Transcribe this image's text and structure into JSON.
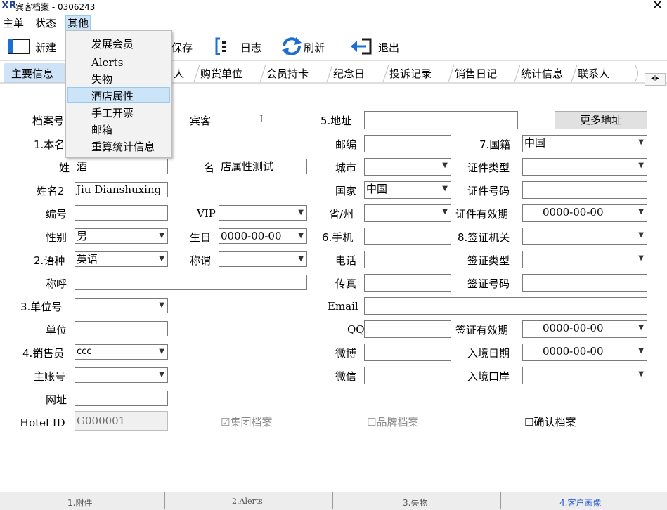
{
  "window": {
    "title": "宾客档案 - 0306243",
    "logo": "XR",
    "close": "✕"
  },
  "menubar": [
    "主单",
    "状态",
    "其他"
  ],
  "toolbar": {
    "new": "新建",
    "save": "保存",
    "log": "日志",
    "refresh": "刷新",
    "exit": "退出"
  },
  "tabs": [
    "主要信息",
    "人",
    "购货单位",
    "会员持卡",
    "纪念日",
    "投诉记录",
    "销售日记",
    "统计信息",
    "联系人"
  ],
  "dropdown_menu": [
    "发展会员",
    "Alerts",
    "失物",
    "酒店属性",
    "手工开票",
    "邮箱",
    "重算统计信息"
  ],
  "left": {
    "archive_no_label": "档案号",
    "guest_label": "宾客",
    "guest_value": "I",
    "name_section_label": "1.本名",
    "surname_label": "姓",
    "surname_value": "酒",
    "given_label": "名",
    "given_value": "店属性测试",
    "name2_label": "姓名2",
    "name2_value": "Jiu Dianshuxing",
    "code_label": "编号",
    "vip_label": "VIP",
    "gender_label": "性别",
    "gender_value": "男",
    "birthday_label": "生日",
    "birthday_value": "0000-00-00",
    "language_label": "2.语种",
    "language_value": "英语",
    "title_label": "称谓",
    "salutation_label": "称呼",
    "unit_no_label": "3.单位号",
    "unit_label": "单位",
    "salesman_label": "4.销售员",
    "salesman_value": "ccc",
    "master_acct_label": "主账号",
    "website_label": "网址",
    "hotel_id_label": "Hotel ID",
    "hotel_id_value": "G000001",
    "group_archive": "☑集团档案",
    "brand_archive": "☐品牌档案",
    "confirm_archive": "☐确认档案"
  },
  "right": {
    "address_label": "5.地址",
    "more_address": "更多地址",
    "zip_label": "邮编",
    "nationality_label": "7.国籍",
    "nationality_value": "中国",
    "city_label": "城市",
    "id_type_label": "证件类型",
    "country_label": "国家",
    "country_value": "中国",
    "id_no_label": "证件号码",
    "province_label": "省/州",
    "id_valid_label": "证件有效期",
    "id_valid_value": "0000-00-00",
    "mobile_label": "6.手机",
    "visa_office_label": "8.签证机关",
    "phone_label": "电话",
    "visa_type_label": "签证类型",
    "fax_label": "传真",
    "visa_no_label": "签证号码",
    "email_label": "Email",
    "qq_label": "QQ",
    "visa_valid_label": "签证有效期",
    "visa_valid_value": "0000-00-00",
    "weibo_label": "微博",
    "entry_date_label": "入境日期",
    "entry_date_value": "0000-00-00",
    "wechat_label": "微信",
    "entry_port_label": "入境口岸"
  },
  "bottom_tabs": [
    "1.附件",
    "2.Alerts",
    "3.失物",
    "4.客户画像"
  ],
  "colors": {
    "accent": "#1c6fd0",
    "highlight": "#cce4f7",
    "active_bottom_tab": "#2a5cd6"
  }
}
